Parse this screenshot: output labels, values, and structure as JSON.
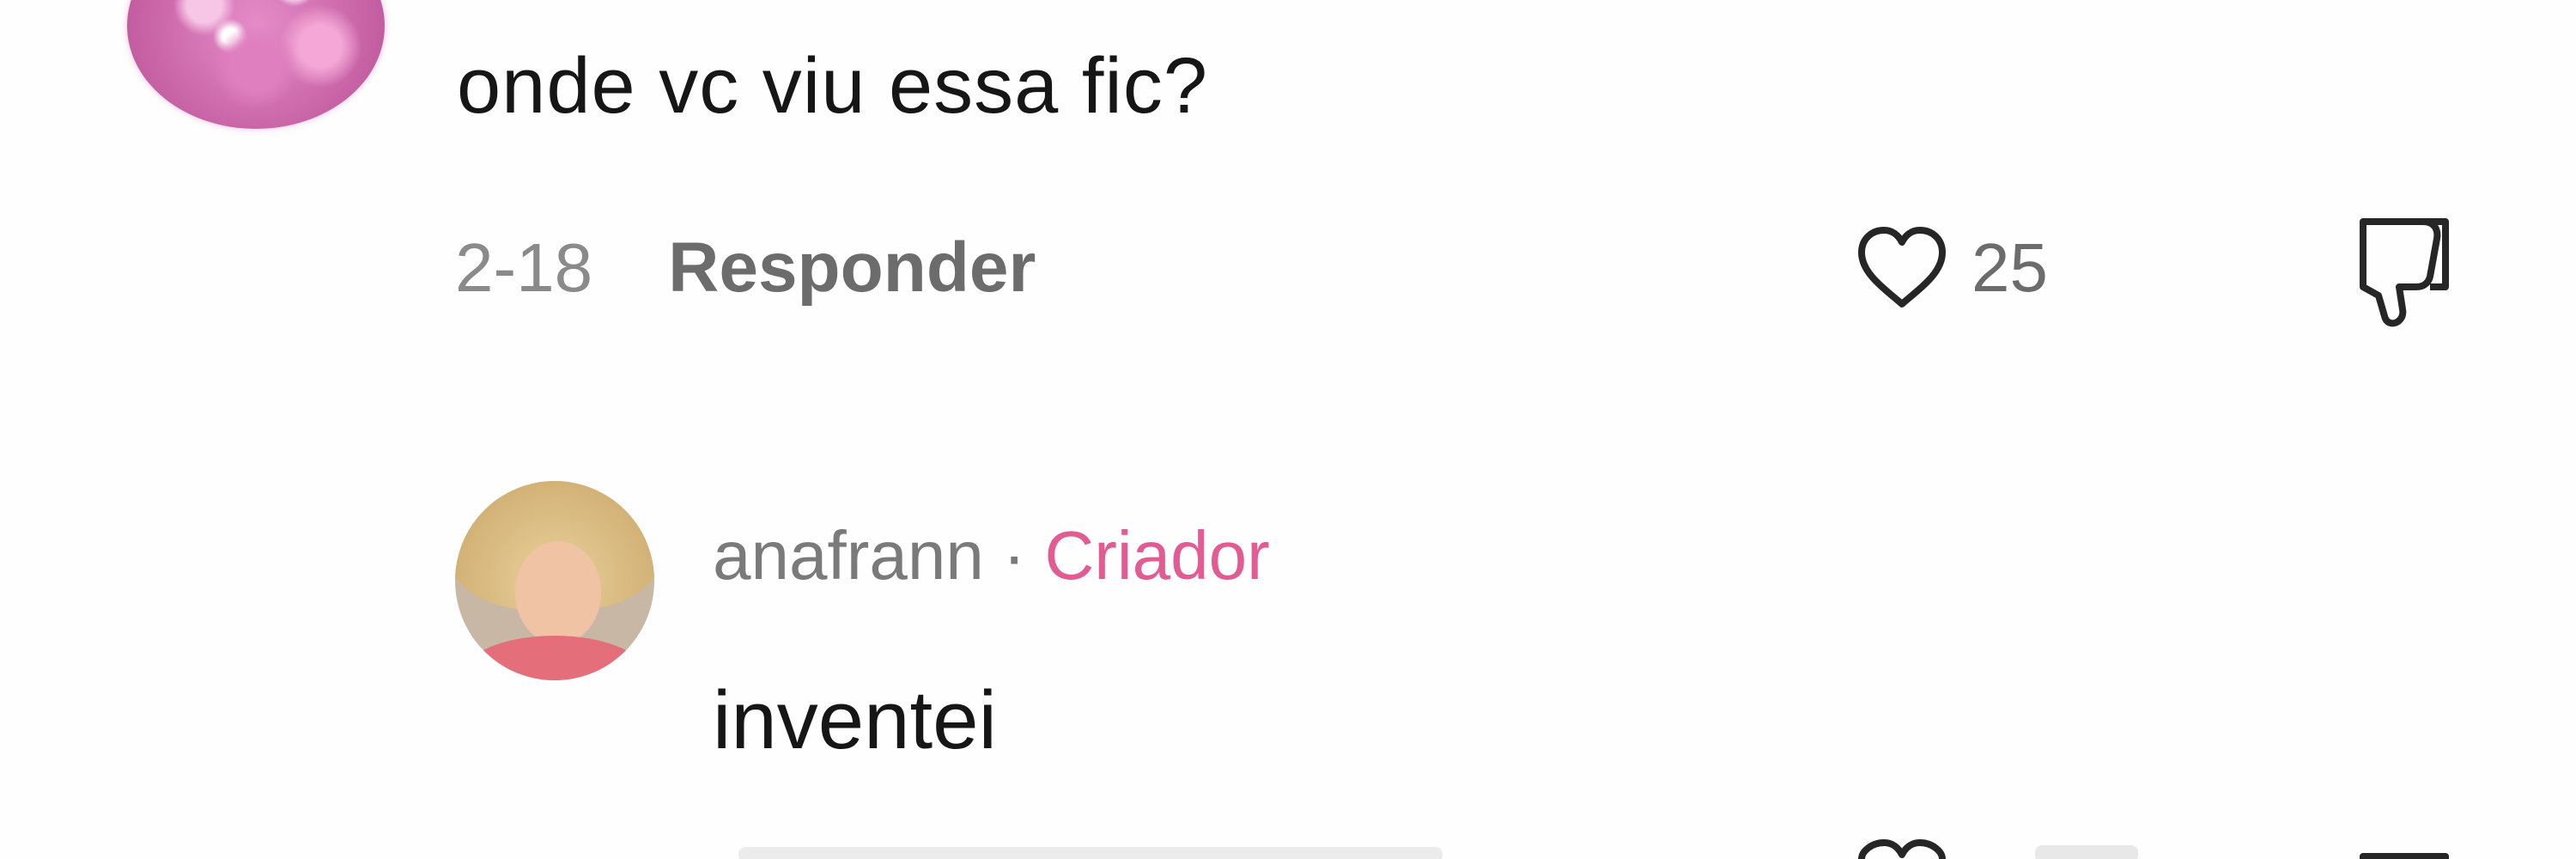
{
  "comments": [
    {
      "text": "onde vc viu essa fic?",
      "date": "2-18",
      "reply_label": "Responder",
      "likes": "25"
    }
  ],
  "reply": {
    "username": "anafrann",
    "separator": "·",
    "badge": "Criador",
    "text": "inventei"
  },
  "colors": {
    "creator_badge": "#e25b93",
    "muted_text": "#7a7a7a",
    "body_text": "#161616"
  },
  "icons": {
    "like": "heart-outline-icon",
    "dislike": "thumbs-down-icon"
  }
}
